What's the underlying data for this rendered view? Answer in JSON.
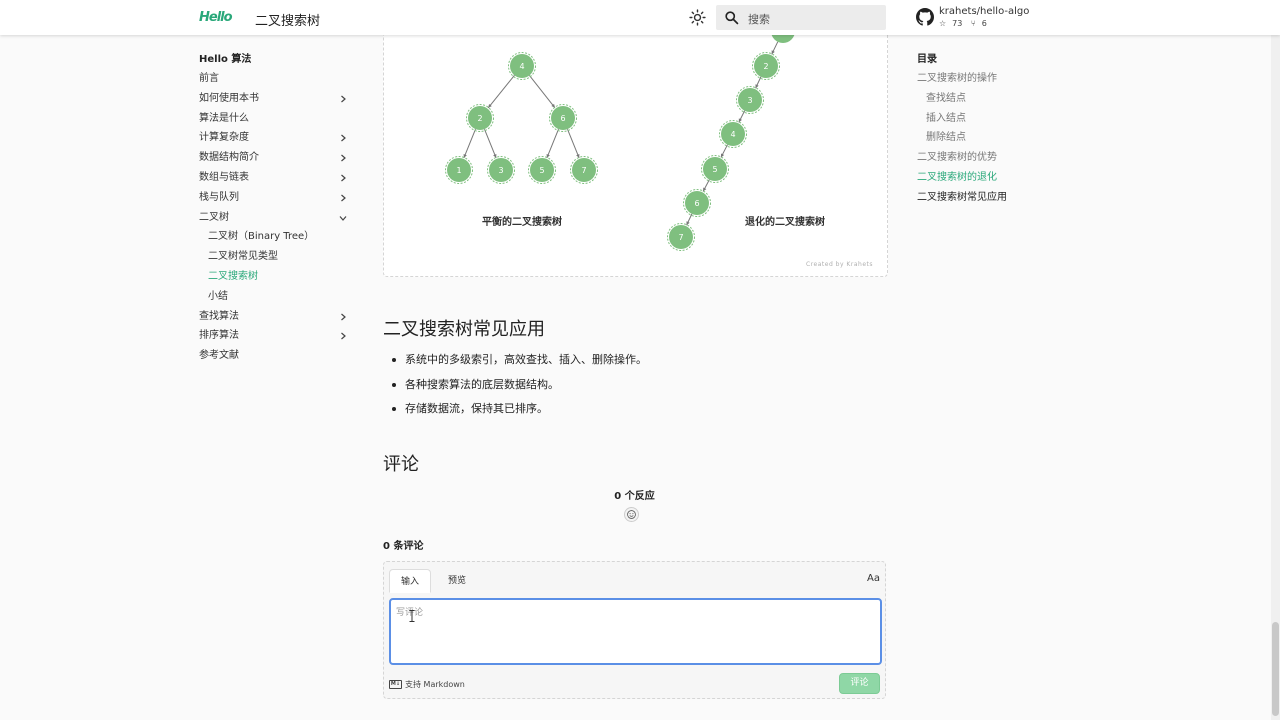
{
  "header": {
    "logo_text": "Hello",
    "title": "二叉搜索树",
    "search_placeholder": "搜索",
    "repo": {
      "name": "krahets/hello-algo",
      "stars": "73",
      "forks": "6"
    }
  },
  "nav": {
    "title": "Hello 算法",
    "items": [
      {
        "label": "前言",
        "expandable": false
      },
      {
        "label": "如何使用本书",
        "expandable": true
      },
      {
        "label": "算法是什么",
        "expandable": false
      },
      {
        "label": "计算复杂度",
        "expandable": true
      },
      {
        "label": "数据结构简介",
        "expandable": true
      },
      {
        "label": "数组与链表",
        "expandable": true
      },
      {
        "label": "栈与队列",
        "expandable": true
      },
      {
        "label": "二叉树",
        "expandable": true,
        "expanded": true
      },
      {
        "label": "二叉树（Binary Tree）",
        "sub": true
      },
      {
        "label": "二叉树常见类型",
        "sub": true
      },
      {
        "label": "二叉搜索树",
        "sub": true,
        "active": true
      },
      {
        "label": "小结",
        "sub": true
      },
      {
        "label": "查找算法",
        "expandable": true
      },
      {
        "label": "排序算法",
        "expandable": true
      },
      {
        "label": "参考文献",
        "expandable": false
      }
    ]
  },
  "toc": {
    "title": "目录",
    "items": [
      {
        "label": "二叉搜索树的操作"
      },
      {
        "label": "查找结点",
        "sub": true
      },
      {
        "label": "插入结点",
        "sub": true
      },
      {
        "label": "删除结点",
        "sub": true
      },
      {
        "label": "二叉搜索树的优势"
      },
      {
        "label": "二叉搜索树的退化",
        "active": true
      },
      {
        "label": "二叉搜索树常见应用",
        "dark": true
      }
    ]
  },
  "figure": {
    "balanced_caption": "平衡的二叉搜索树",
    "degenerate_caption": "退化的二叉搜索树",
    "credit": "Created by Krahets",
    "balanced_nodes": [
      "4",
      "2",
      "6",
      "1",
      "3",
      "5",
      "7"
    ],
    "degenerate_nodes": [
      "2",
      "3",
      "4",
      "5",
      "6",
      "7"
    ],
    "node_color": "#7fbf7f"
  },
  "content": {
    "section_title": "二叉搜索树常见应用",
    "bullets": [
      "系统中的多级索引，高效查找、插入、删除操作。",
      "各种搜索算法的底层数据结构。",
      "存储数据流，保持其已排序。"
    ]
  },
  "comments": {
    "title": "评论",
    "reactions_title": "0 个反应",
    "count_label": "0 条评论",
    "tab_write": "输入",
    "tab_preview": "预览",
    "aa_label": "Aa",
    "placeholder": "写评论",
    "markdown_hint": "支持 Markdown",
    "md_icon_text": "M↓",
    "submit_label": "评论"
  },
  "colors": {
    "accent": "#2aa87a",
    "focus_border": "#5b8fe6",
    "submit": "#8fd7a6"
  }
}
